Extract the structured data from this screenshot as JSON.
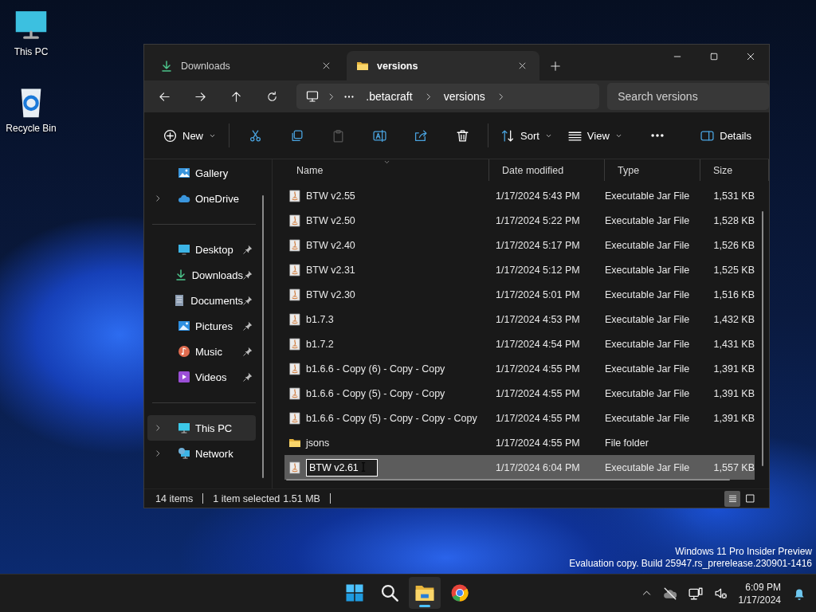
{
  "desktop_icons": [
    {
      "label": "This PC",
      "kind": "pc"
    },
    {
      "label": "Recycle Bin",
      "kind": "bin"
    }
  ],
  "window": {
    "tabs": [
      {
        "label": "Downloads",
        "kind": "download",
        "selected": false
      },
      {
        "label": "versions",
        "kind": "folder",
        "selected": true
      }
    ],
    "breadcrumb": [
      ".betacraft",
      "versions"
    ],
    "search": {
      "placeholder": "Search versions"
    },
    "toolbar": {
      "groups": [
        [
          {
            "kind": "new",
            "label": "New",
            "dropdown": true,
            "disabled": false
          }
        ],
        [
          {
            "kind": "cut",
            "dropdown": false,
            "disabled": false
          },
          {
            "kind": "copy",
            "dropdown": false,
            "disabled": false
          },
          {
            "kind": "paste",
            "dropdown": false,
            "disabled": true
          },
          {
            "kind": "rename",
            "dropdown": false,
            "disabled": false
          },
          {
            "kind": "share",
            "dropdown": false,
            "disabled": false
          },
          {
            "kind": "delete",
            "dropdown": false,
            "disabled": false
          }
        ],
        [
          {
            "kind": "sort",
            "label": "Sort",
            "dropdown": true,
            "disabled": false
          },
          {
            "kind": "view",
            "label": "View",
            "dropdown": true,
            "disabled": false
          },
          {
            "kind": "more",
            "dropdown": false,
            "disabled": false
          }
        ]
      ],
      "details": {
        "label": "Details"
      }
    },
    "sidebar": {
      "groups": [
        [
          {
            "label": "Gallery",
            "kind": "gallery",
            "expandable": false,
            "pinned": false,
            "selected": false
          },
          {
            "label": "OneDrive",
            "kind": "cloud",
            "expandable": true,
            "pinned": false,
            "selected": false
          }
        ],
        [
          {
            "label": "Desktop",
            "kind": "desktop",
            "expandable": false,
            "pinned": true,
            "selected": false
          },
          {
            "label": "Downloads",
            "kind": "download",
            "expandable": false,
            "pinned": true,
            "selected": false
          },
          {
            "label": "Documents",
            "kind": "document",
            "expandable": false,
            "pinned": true,
            "selected": false
          },
          {
            "label": "Pictures",
            "kind": "picture",
            "expandable": false,
            "pinned": true,
            "selected": false
          },
          {
            "label": "Music",
            "kind": "music",
            "expandable": false,
            "pinned": true,
            "selected": false
          },
          {
            "label": "Videos",
            "kind": "video",
            "expandable": false,
            "pinned": true,
            "selected": false
          }
        ],
        [
          {
            "label": "This PC",
            "kind": "pc",
            "expandable": true,
            "pinned": false,
            "selected": true
          },
          {
            "label": "Network",
            "kind": "network",
            "expandable": true,
            "pinned": false,
            "selected": false
          }
        ]
      ]
    },
    "columns": [
      {
        "label": "Name",
        "sorted": true
      },
      {
        "label": "Date modified",
        "sorted": false
      },
      {
        "label": "Type",
        "sorted": false
      },
      {
        "label": "Size",
        "sorted": false
      }
    ],
    "rows": [
      {
        "name": "BTW v2.55",
        "date": "1/17/2024 5:43 PM",
        "type": "Executable Jar File",
        "size": "1,531 KB",
        "kind": "jar",
        "selected": false,
        "renaming": false
      },
      {
        "name": "BTW v2.50",
        "date": "1/17/2024 5:22 PM",
        "type": "Executable Jar File",
        "size": "1,528 KB",
        "kind": "jar",
        "selected": false,
        "renaming": false
      },
      {
        "name": "BTW v2.40",
        "date": "1/17/2024 5:17 PM",
        "type": "Executable Jar File",
        "size": "1,526 KB",
        "kind": "jar",
        "selected": false,
        "renaming": false
      },
      {
        "name": "BTW v2.31",
        "date": "1/17/2024 5:12 PM",
        "type": "Executable Jar File",
        "size": "1,525 KB",
        "kind": "jar",
        "selected": false,
        "renaming": false
      },
      {
        "name": "BTW v2.30",
        "date": "1/17/2024 5:01 PM",
        "type": "Executable Jar File",
        "size": "1,516 KB",
        "kind": "jar",
        "selected": false,
        "renaming": false
      },
      {
        "name": "b1.7.3",
        "date": "1/17/2024 4:53 PM",
        "type": "Executable Jar File",
        "size": "1,432 KB",
        "kind": "jar",
        "selected": false,
        "renaming": false
      },
      {
        "name": "b1.7.2",
        "date": "1/17/2024 4:54 PM",
        "type": "Executable Jar File",
        "size": "1,431 KB",
        "kind": "jar",
        "selected": false,
        "renaming": false
      },
      {
        "name": "b1.6.6 - Copy (6) - Copy - Copy",
        "date": "1/17/2024 4:55 PM",
        "type": "Executable Jar File",
        "size": "1,391 KB",
        "kind": "jar",
        "selected": false,
        "renaming": false
      },
      {
        "name": "b1.6.6 - Copy (5) - Copy - Copy",
        "date": "1/17/2024 4:55 PM",
        "type": "Executable Jar File",
        "size": "1,391 KB",
        "kind": "jar",
        "selected": false,
        "renaming": false
      },
      {
        "name": "b1.6.6 - Copy (5) - Copy - Copy - Copy",
        "date": "1/17/2024 4:55 PM",
        "type": "Executable Jar File",
        "size": "1,391 KB",
        "kind": "jar",
        "selected": false,
        "renaming": false
      },
      {
        "name": "jsons",
        "date": "1/17/2024 4:55 PM",
        "type": "File folder",
        "kind": "folder",
        "selected": false,
        "renaming": false
      },
      {
        "name": "BTW v2.61",
        "date": "1/17/2024 6:04 PM",
        "type": "Executable Jar File",
        "size": "1,557 KB",
        "kind": "jar",
        "selected": true,
        "renaming": true
      }
    ],
    "status_bar": {
      "item_count": "14 items",
      "selection": "1 item selected",
      "selection_size": "1.51 MB"
    },
    "view_modes": [
      {
        "kind": "details",
        "selected": true
      },
      {
        "kind": "tiles",
        "selected": false
      }
    ]
  },
  "build_info": [
    "Windows 11 Pro Insider Preview",
    "Evaluation copy. Build 25947.rs_prerelease.230901-1416"
  ],
  "taskbar": {
    "apps": [
      {
        "kind": "start",
        "selected": false
      },
      {
        "kind": "search",
        "selected": false
      },
      {
        "kind": "explorer",
        "selected": true
      },
      {
        "kind": "browser",
        "selected": false
      }
    ],
    "tray": {
      "time": "6:09 PM",
      "date": "1/17/2024"
    }
  }
}
